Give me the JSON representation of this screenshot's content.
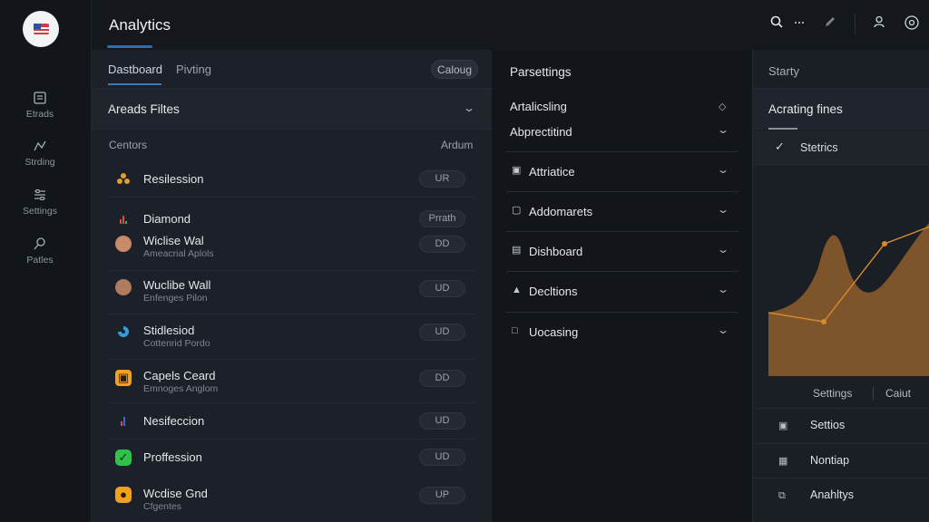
{
  "app": {
    "title": "Analytics"
  },
  "rail": {
    "items": [
      {
        "label": "Etrads",
        "icon": "dashboard-icon"
      },
      {
        "label": "Strding",
        "icon": "chart-icon"
      },
      {
        "label": "Settings",
        "icon": "sliders-icon"
      },
      {
        "label": "Patles",
        "icon": "pin-icon"
      }
    ]
  },
  "topbar": {
    "icons": [
      "search-icon",
      "more-icon",
      "edit-icon",
      "user-icon",
      "settings-icon"
    ]
  },
  "left": {
    "tabs": [
      {
        "label": "Dastboard",
        "active": true
      },
      {
        "label": "Pivting",
        "active": false
      }
    ],
    "pill_label": "Caloug",
    "filters_title": "Areads Filtes",
    "col_left": "Centors",
    "col_right": "Ardum",
    "rows": [
      {
        "name": "Resilession",
        "sub": "",
        "btn": "UR",
        "icon": "cluster-icon",
        "color": "#e0a030"
      },
      {
        "name": "Diamond",
        "sub": "",
        "btn": "Prrath",
        "icon": "bar-chart-icon",
        "color": "#d94a4a"
      },
      {
        "name": "Wiclise Wal",
        "sub": "Ameacrial Aplols",
        "btn": "DD",
        "icon": "avatar-icon",
        "color": "#c98a6a"
      },
      {
        "name": "Wuclibe Wall",
        "sub": "Enfenges Pilon",
        "btn": "UD",
        "icon": "avatar-icon",
        "color": "#b07a60"
      },
      {
        "name": "Stidlesiod",
        "sub": "Cottenrid Pordo",
        "btn": "UD",
        "icon": "swirl-icon",
        "color": "#3a9ad9"
      },
      {
        "name": "Capels Ceard",
        "sub": "Emnoges Anglom",
        "btn": "DD",
        "icon": "card-icon",
        "color": "#f0a020"
      },
      {
        "name": "Nesifeccion",
        "sub": "",
        "btn": "UD",
        "icon": "bar-chart-icon",
        "color": "#d94a4a"
      },
      {
        "name": "Proffession",
        "sub": "",
        "btn": "UD",
        "icon": "check-icon",
        "color": "#2fbf4a"
      },
      {
        "name": "Wcdise Gnd",
        "sub": "Cfgentes",
        "btn": "UP",
        "icon": "badge-icon",
        "color": "#f0a020"
      }
    ]
  },
  "mid": {
    "title": "Parsettings",
    "plain_items": [
      "Artalicsling",
      "Abprectitind"
    ],
    "rows": [
      {
        "label": "Attriatice",
        "icon": "panel-icon"
      },
      {
        "label": "Addomarets",
        "icon": "tag-icon"
      },
      {
        "label": "Dishboard",
        "icon": "document-icon"
      },
      {
        "label": "Decltions",
        "icon": "lock-icon"
      },
      {
        "label": "Uocasing",
        "icon": "file-icon"
      }
    ]
  },
  "right": {
    "head": "Starty",
    "title": "Acrating fines",
    "check_label": "Stetrics",
    "footer_left": "Settings",
    "footer_right": "Caiut",
    "rows": [
      {
        "label": "Settios",
        "icon": "edit-box-icon"
      },
      {
        "label": "Nontiap",
        "icon": "grid-icon"
      },
      {
        "label": "Anahltys",
        "icon": "copy-icon"
      }
    ],
    "chart_colors": {
      "area": "#8a5a2b",
      "line": "#d98a2e"
    }
  }
}
